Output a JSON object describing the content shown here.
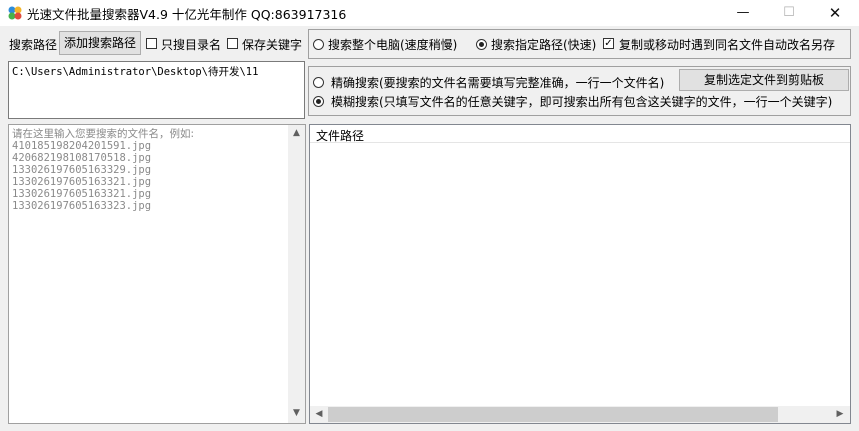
{
  "window": {
    "title": "光速文件批量搜索器V4.9 十亿光年制作 QQ:863917316",
    "minimize_glyph": "—",
    "maximize_glyph": "☐",
    "close_glyph": "✕"
  },
  "toolbar": {
    "search_path_label": "搜索路径",
    "add_path_button": "添加搜索路径",
    "only_dirs_label": "只搜目录名",
    "only_dirs_checked": false,
    "save_keywords_label": "保存关键字",
    "save_keywords_checked": false
  },
  "scope": {
    "whole_pc_label": "搜索整个电脑(速度稍慢)",
    "whole_pc_selected": false,
    "specified_path_label": "搜索指定路径(快速)",
    "specified_path_selected": true,
    "auto_rename_label": "复制或移动时遇到同名文件自动改名另存",
    "auto_rename_checked": true
  },
  "path_box": {
    "value": "C:\\Users\\Administrator\\Desktop\\待开发\\11"
  },
  "mode": {
    "exact_label": "精确搜索(要搜索的文件名需要填写完整准确，一行一个文件名)",
    "exact_selected": false,
    "fuzzy_label": "模糊搜索(只填写文件名的任意关键字，即可搜索出所有包含这关键字的文件，一行一个关键字)",
    "fuzzy_selected": true,
    "copy_button": "复制选定文件到剪贴板"
  },
  "input_box": {
    "placeholder_lines": [
      "请在这里输入您要搜索的文件名，例如:",
      "410185198204201591.jpg",
      "420682198108170518.jpg",
      "133026197605163329.jpg",
      "133026197605163321.jpg",
      "133026197605163321.jpg",
      "133026197605163323.jpg"
    ]
  },
  "results": {
    "column_header": "文件路径"
  },
  "icons": {
    "app": "app-icon",
    "scroll_up": "▲",
    "scroll_down": "▼",
    "scroll_left": "◀",
    "scroll_right": "▶"
  },
  "colors": {
    "background": "#f0f0f0",
    "titlebar": "#ffffff",
    "placeholder_text": "#8a8a8a"
  }
}
